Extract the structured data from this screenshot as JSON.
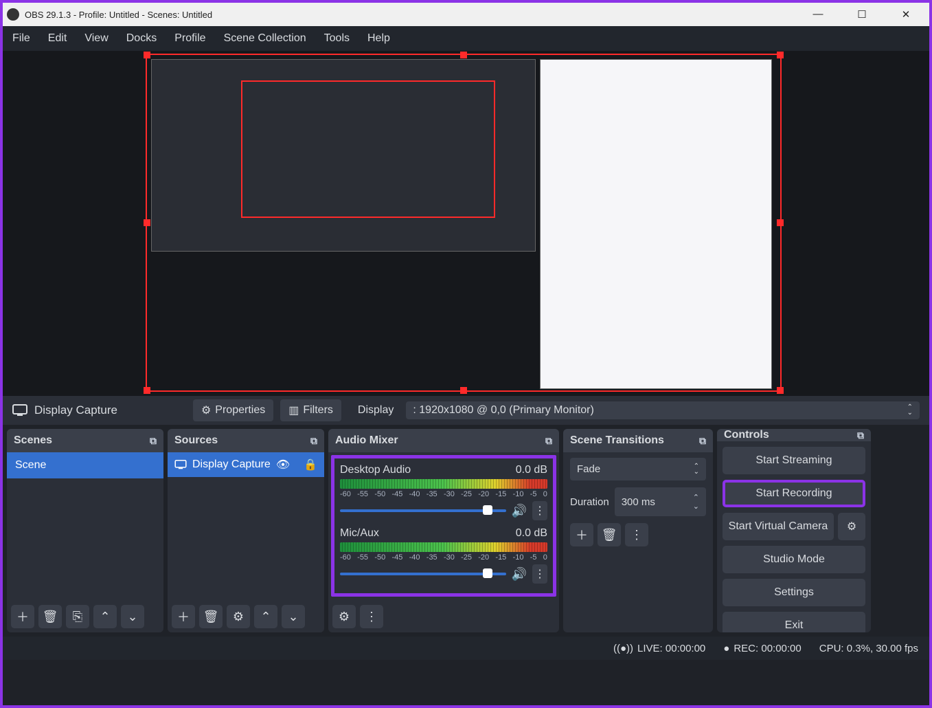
{
  "window": {
    "title": "OBS 29.1.3 - Profile: Untitled - Scenes: Untitled"
  },
  "menu": [
    "File",
    "Edit",
    "View",
    "Docks",
    "Profile",
    "Scene Collection",
    "Tools",
    "Help"
  ],
  "source_toolbar": {
    "current_source": "Display Capture",
    "properties": "Properties",
    "filters": "Filters",
    "display_label": "Display",
    "display_value": ": 1920x1080 @ 0,0 (Primary Monitor)"
  },
  "panels": {
    "scenes": {
      "title": "Scenes",
      "items": [
        "Scene"
      ]
    },
    "sources": {
      "title": "Sources",
      "items": [
        "Display Capture"
      ]
    },
    "mixer": {
      "title": "Audio Mixer",
      "ticks": [
        "-60",
        "-55",
        "-50",
        "-45",
        "-40",
        "-35",
        "-30",
        "-25",
        "-20",
        "-15",
        "-10",
        "-5",
        "0"
      ],
      "channels": [
        {
          "name": "Desktop Audio",
          "level": "0.0 dB"
        },
        {
          "name": "Mic/Aux",
          "level": "0.0 dB"
        }
      ]
    },
    "transitions": {
      "title": "Scene Transitions",
      "type": "Fade",
      "duration_label": "Duration",
      "duration_value": "300 ms"
    },
    "controls": {
      "title": "Controls",
      "buttons": {
        "stream": "Start Streaming",
        "record": "Start Recording",
        "vcam": "Start Virtual Camera",
        "studio": "Studio Mode",
        "settings": "Settings",
        "exit": "Exit"
      }
    }
  },
  "statusbar": {
    "live": "LIVE: 00:00:00",
    "rec": "REC: 00:00:00",
    "cpu": "CPU: 0.3%, 30.00 fps"
  }
}
